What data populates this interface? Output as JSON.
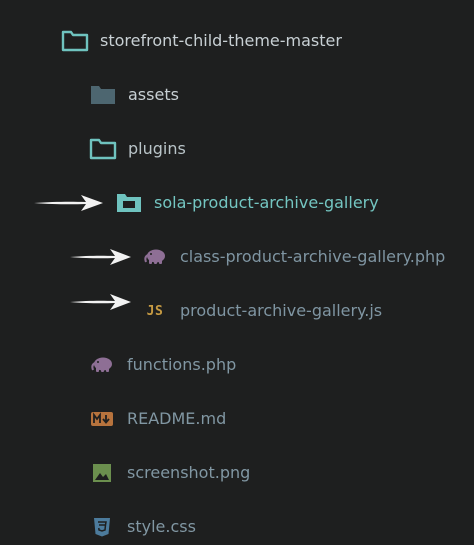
{
  "explorer": {
    "root": {
      "label": "storefront-child-theme-master",
      "icon": "folder-open-icon"
    },
    "items": [
      {
        "label": "assets",
        "icon": "folder-closed-icon"
      },
      {
        "label": "plugins",
        "icon": "folder-open-icon"
      },
      {
        "label": "sola-product-archive-gallery",
        "icon": "folder-open-icon"
      },
      {
        "label": "class-product-archive-gallery.php",
        "icon": "php-icon"
      },
      {
        "label": "product-archive-gallery.js",
        "icon": "js-icon",
        "icon_text": "JS"
      },
      {
        "label": "functions.php",
        "icon": "php-icon"
      },
      {
        "label": "README.md",
        "icon": "markdown-icon"
      },
      {
        "label": "screenshot.png",
        "icon": "image-icon"
      },
      {
        "label": "style.css",
        "icon": "css-icon"
      }
    ]
  },
  "colors": {
    "background": "#1e1f1f",
    "folder_accent": "#6fc3bf",
    "closed_folder": "#4d6670",
    "php": "#8e6f95",
    "js": "#c79b43",
    "markdown": "#b7733d",
    "image": "#6b8f4e",
    "css": "#4c7b9c",
    "arrow": "#f2f2f2"
  }
}
